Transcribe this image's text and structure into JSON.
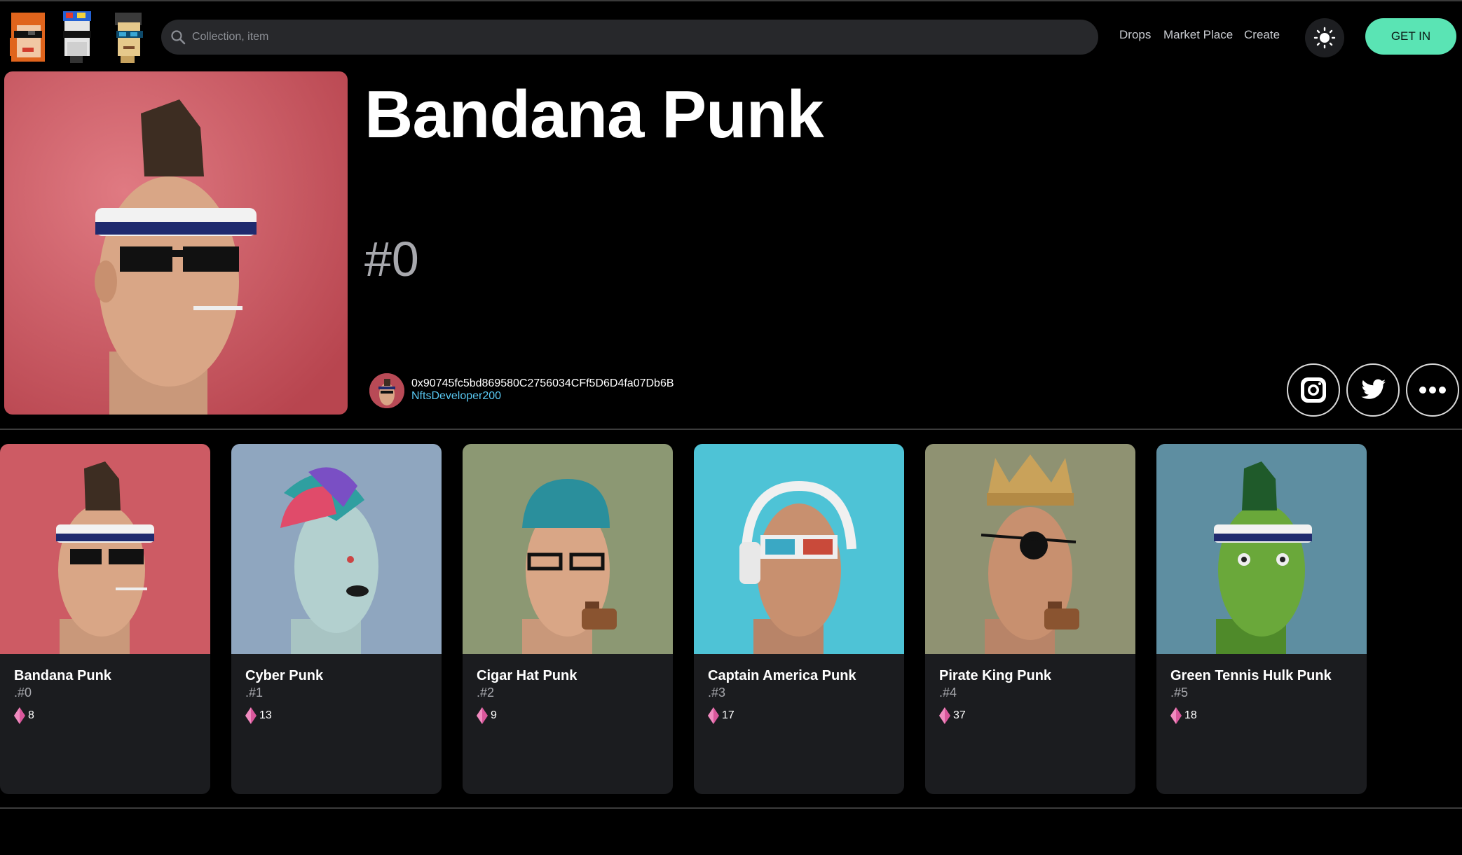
{
  "header": {
    "search_placeholder": "Collection, item",
    "nav": [
      "Drops",
      "Market Place",
      "Create"
    ],
    "cta_label": "GET IN",
    "accent_color": "#5ae4b4"
  },
  "hero": {
    "title": "Bandana Punk",
    "token_number": "#0",
    "owner_address": "0x90745fc5bd869580C2756034CFf5D6D4fa07Db6B",
    "owner_name": "NftsDeveloper200",
    "social_buttons": [
      "instagram-icon",
      "twitter-icon",
      "more-icon"
    ]
  },
  "cards": [
    {
      "name": "Bandana Punk",
      "number": ".#0",
      "price": "8",
      "bg": "#cd5b64"
    },
    {
      "name": "Cyber Punk",
      "number": ".#1",
      "price": "13",
      "bg": "#8fa6bf"
    },
    {
      "name": "Cigar Hat Punk",
      "number": ".#2",
      "price": "9",
      "bg": "#8c9873"
    },
    {
      "name": "Captain America Punk",
      "number": ".#3",
      "price": "17",
      "bg": "#4ec3d6"
    },
    {
      "name": "Pirate King Punk",
      "number": ".#4",
      "price": "37",
      "bg": "#8f9272"
    },
    {
      "name": "Green Tennis Hulk Punk",
      "number": ".#5",
      "price": "18",
      "bg": "#5e8ea1"
    }
  ]
}
